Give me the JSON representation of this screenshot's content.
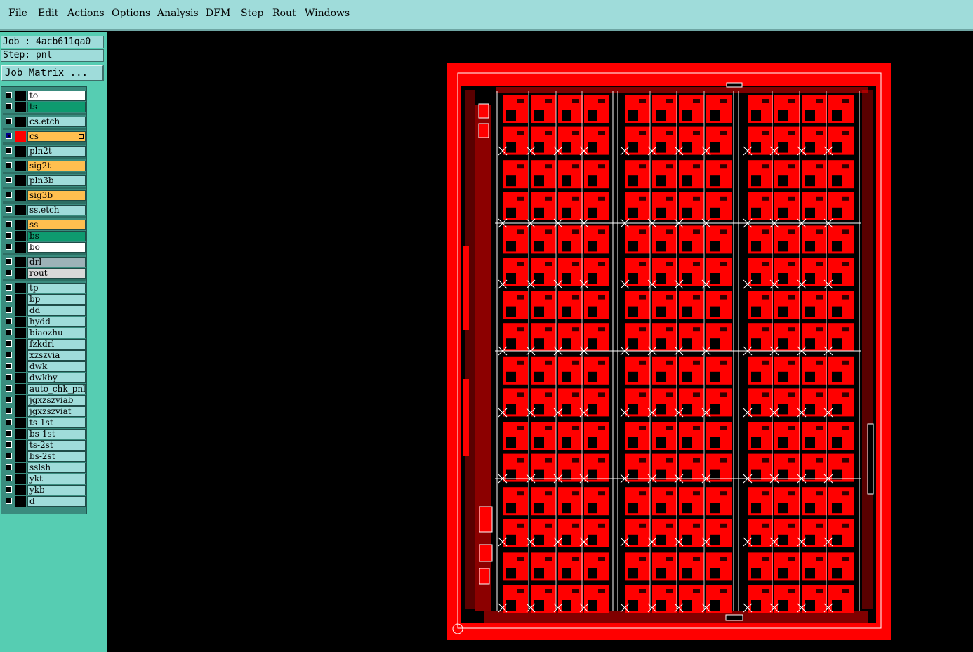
{
  "menu": [
    "File",
    "Edit",
    "Actions",
    "Options",
    "Analysis",
    "DFM",
    "Step",
    "Rout",
    "Windows"
  ],
  "job": {
    "job_label": "Job : 4acb611qa0",
    "step_label": "Step: pnl",
    "matrix_button": "Job Matrix ..."
  },
  "layers": [
    {
      "name": "to",
      "color": "white"
    },
    {
      "name": "ts",
      "color": "green"
    },
    {
      "name": "cs.etch",
      "color": "cyan"
    },
    {
      "name": "cs",
      "color": "orange",
      "active": true
    },
    {
      "name": "pln2t",
      "color": "cyan"
    },
    {
      "name": "sig2t",
      "color": "orange"
    },
    {
      "name": "pln3b",
      "color": "cyan"
    },
    {
      "name": "sig3b",
      "color": "orange"
    },
    {
      "name": "ss.etch",
      "color": "cyan"
    },
    {
      "name": "ss",
      "color": "orange"
    },
    {
      "name": "bs",
      "color": "green"
    },
    {
      "name": "bo",
      "color": "white"
    },
    {
      "name": "drl",
      "color": "grey"
    },
    {
      "name": "rout",
      "color": "lgrey"
    },
    {
      "name": "tp",
      "color": "cyan"
    },
    {
      "name": "bp",
      "color": "cyan"
    },
    {
      "name": "dd",
      "color": "cyan"
    },
    {
      "name": "hydd",
      "color": "cyan"
    },
    {
      "name": "biaozhu",
      "color": "cyan"
    },
    {
      "name": "fzkdrl",
      "color": "cyan"
    },
    {
      "name": "xzszvia",
      "color": "cyan"
    },
    {
      "name": "dwk",
      "color": "cyan"
    },
    {
      "name": "dwkby",
      "color": "cyan"
    },
    {
      "name": "auto_chk_pnl",
      "color": "cyan"
    },
    {
      "name": "jgxzszviab",
      "color": "cyan"
    },
    {
      "name": "jgxzszviat",
      "color": "cyan"
    },
    {
      "name": "ts-1st",
      "color": "cyan"
    },
    {
      "name": "bs-1st",
      "color": "cyan"
    },
    {
      "name": "ts-2st",
      "color": "cyan"
    },
    {
      "name": "bs-2st",
      "color": "cyan"
    },
    {
      "name": "sslsh",
      "color": "cyan"
    },
    {
      "name": "ykt",
      "color": "cyan"
    },
    {
      "name": "ykb",
      "color": "cyan"
    },
    {
      "name": "d",
      "color": "cyan"
    }
  ],
  "colors": {
    "panel_red": "#ff0000",
    "background": "#000000",
    "menubar": "#9fdcda",
    "sidebar": "#56cdb2"
  }
}
